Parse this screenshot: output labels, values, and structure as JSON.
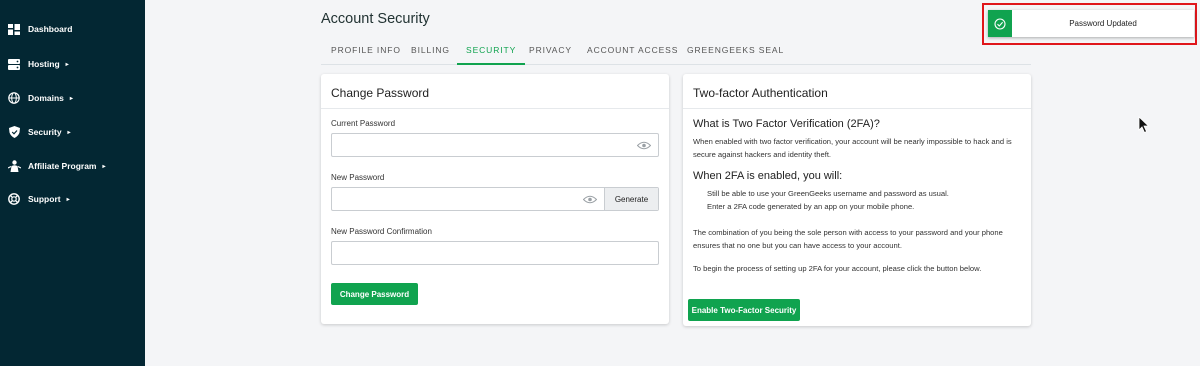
{
  "sidebar": {
    "items": [
      {
        "label": "Dashboard",
        "icon": "dashboard-icon",
        "caret": ""
      },
      {
        "label": "Hosting",
        "icon": "server-icon",
        "caret": "▸"
      },
      {
        "label": "Domains",
        "icon": "globe-icon",
        "caret": "▸"
      },
      {
        "label": "Security",
        "icon": "shield-icon",
        "caret": "▸"
      },
      {
        "label": "Affiliate Program",
        "icon": "affiliate-icon",
        "caret": "▸"
      },
      {
        "label": "Support",
        "icon": "support-icon",
        "caret": "▸"
      }
    ]
  },
  "page": {
    "title": "Account Security",
    "tabs": [
      "PROFILE INFO",
      "BILLING",
      "SECURITY",
      "PRIVACY",
      "ACCOUNT ACCESS",
      "GREENGEEKS SEAL"
    ],
    "active_tab": "SECURITY"
  },
  "change_password": {
    "title": "Change Password",
    "current_label": "Current Password",
    "current_value": "",
    "new_label": "New Password",
    "new_value": "",
    "generate_label": "Generate",
    "confirm_label": "New Password Confirmation",
    "confirm_value": "",
    "submit_label": "Change Password"
  },
  "two_factor": {
    "title": "Two-factor Authentication",
    "what_heading": "What is Two Factor Verification (2FA)?",
    "what_text": "When enabled with two factor verification, your account will be nearly impossible to hack and is secure against hackers and identity theft.",
    "when_heading": "When 2FA is enabled, you will:",
    "bullet_1": "Still be able to use your GreenGeeks username and password as usual.",
    "bullet_2": "Enter a 2FA code generated by an app on your mobile phone.",
    "combination_text": "The combination of you being the sole person with access to your password and your phone ensures that no one but you can have access to your account.",
    "begin_text": "To begin the process of setting up 2FA for your account, please click the button below.",
    "enable_label": "Enable Two-Factor Security"
  },
  "toast": {
    "message": "Password Updated",
    "icon": "check-circle-icon"
  },
  "colors": {
    "sidebar_bg": "#032733",
    "accent_green": "#10a34f",
    "highlight_red": "#e0161b"
  }
}
